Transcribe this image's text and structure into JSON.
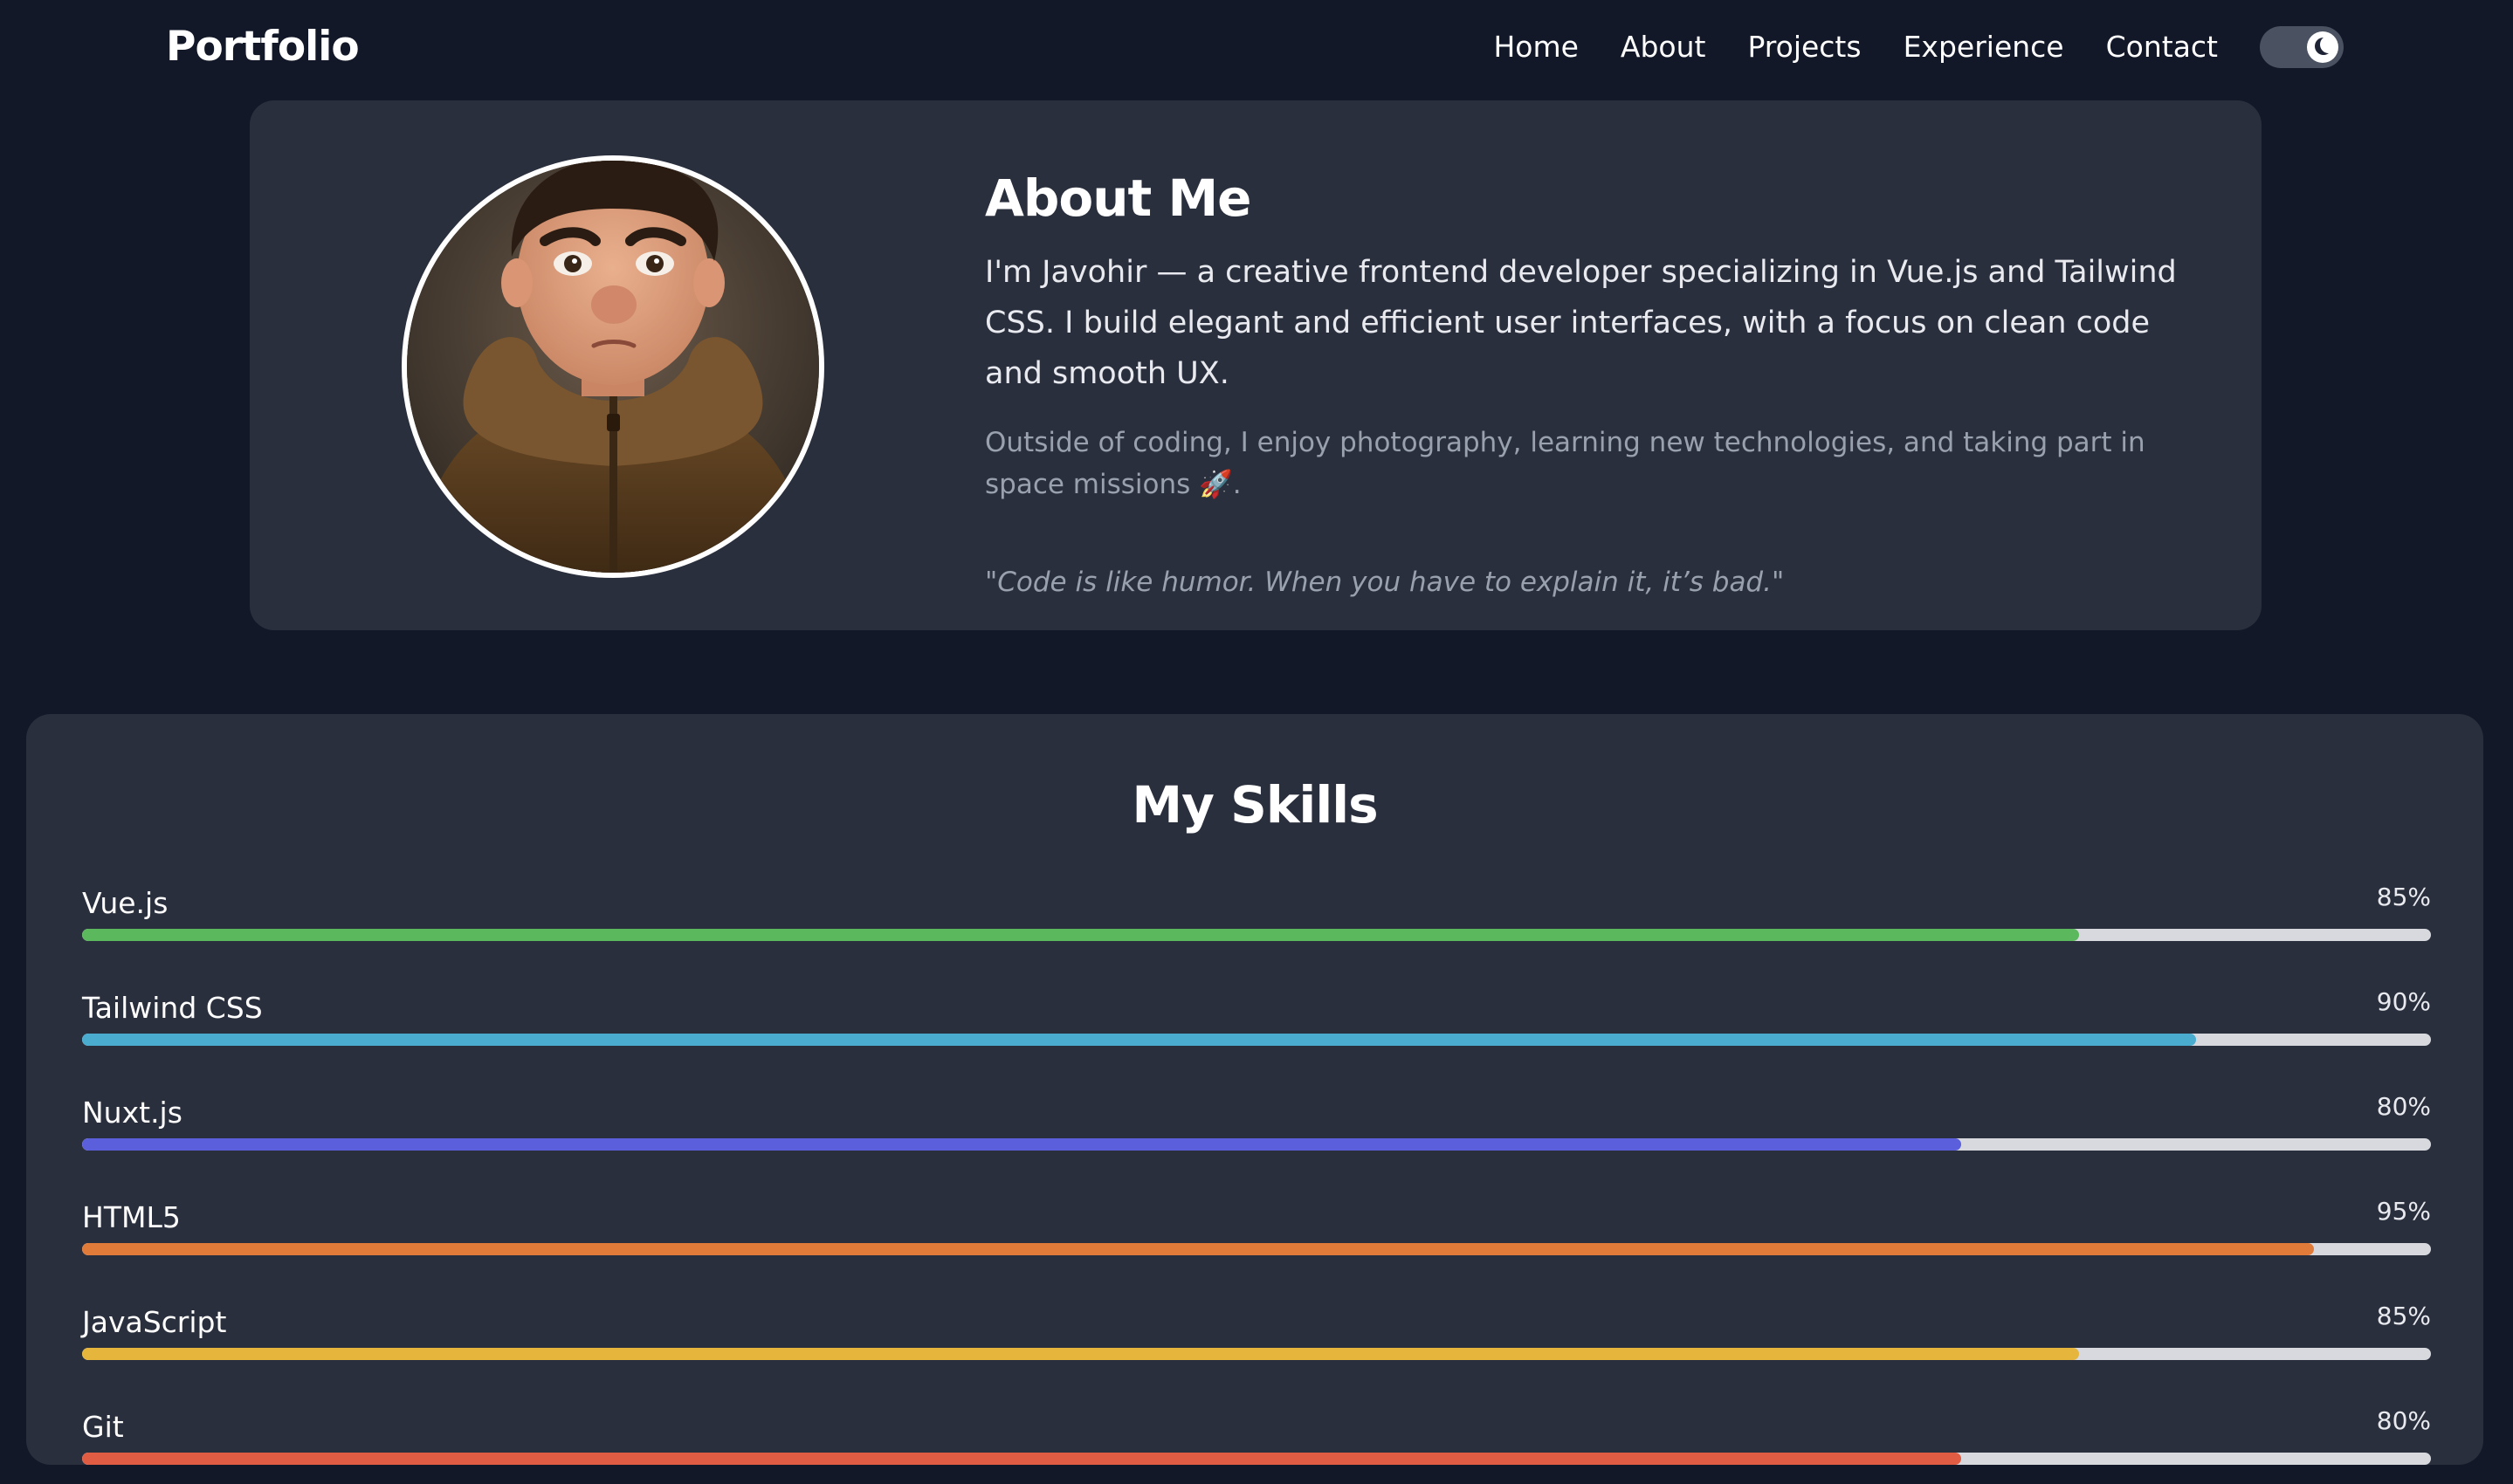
{
  "nav": {
    "brand": "Portfolio",
    "links": [
      "Home",
      "About",
      "Projects",
      "Experience",
      "Contact"
    ],
    "theme_toggle_icon": "moon-icon"
  },
  "about": {
    "title": "About Me",
    "paragraph1": "I'm Javohir — a creative frontend developer specializing in Vue.js and Tailwind CSS. I build elegant and efficient user interfaces, with a focus on clean code and smooth UX.",
    "paragraph2": "Outside of coding, I enjoy photography, learning new technologies, and taking part in space missions 🚀.",
    "quote": "\"Code is like humor. When you have to explain it, it’s bad.\"",
    "avatar_icon": "avatar-portrait"
  },
  "skills": {
    "title": "My Skills",
    "items": [
      {
        "name": "Vue.js",
        "percent_label": "85%",
        "level": 85,
        "color": "#5cb85c"
      },
      {
        "name": "Tailwind CSS",
        "percent_label": "90%",
        "level": 90,
        "color": "#4aaccf"
      },
      {
        "name": "Nuxt.js",
        "percent_label": "80%",
        "level": 80,
        "color": "#5b5fdb"
      },
      {
        "name": "HTML5",
        "percent_label": "95%",
        "level": 95,
        "color": "#e07b39"
      },
      {
        "name": "JavaScript",
        "percent_label": "85%",
        "level": 85,
        "color": "#e6b53b"
      },
      {
        "name": "Git",
        "percent_label": "80%",
        "level": 80,
        "color": "#e05d44"
      }
    ]
  },
  "colors": {
    "background": "#121828",
    "card": "#2a2f3d",
    "track": "#d7d9de"
  }
}
